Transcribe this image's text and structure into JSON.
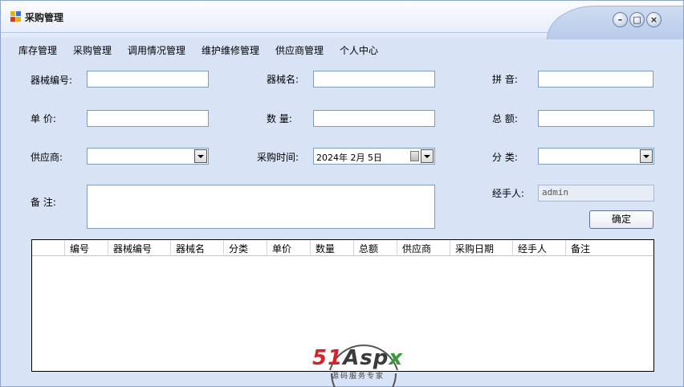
{
  "window": {
    "title": "采购管理",
    "controls": {
      "minimize_icon": "minimize-icon",
      "maximize_icon": "maximize-icon",
      "close_icon": "close-icon"
    }
  },
  "menu": {
    "items": [
      "库存管理",
      "采购管理",
      "调用情况管理",
      "维护维修管理",
      "供应商管理",
      "个人中心"
    ]
  },
  "form": {
    "equipment_no_label": "器械编号:",
    "equipment_name_label": "器械名:",
    "pinyin_label": "拼  音:",
    "unit_price_label": "单  价:",
    "quantity_label": "数  量:",
    "total_label": "总  额:",
    "supplier_label": "供应商:",
    "purchase_time_label": "采购时间:",
    "purchase_time_value": "2024年 2月 5日",
    "category_label": "分  类:",
    "remark_label": "备  注:",
    "handler_label": "经手人:",
    "handler_value": "admin",
    "confirm_label": "确定"
  },
  "grid": {
    "columns": [
      "",
      "编号",
      "器械编号",
      "器械名",
      "分类",
      "单价",
      "数量",
      "总额",
      "供应商",
      "采购日期",
      "经手人",
      "备注"
    ],
    "rows": []
  },
  "watermark": {
    "brand": "51Aspx",
    "tagline": "源码服务专家"
  },
  "colors": {
    "window_bg": "#d9e3f6",
    "border": "#7f9db9",
    "brand_red": "#d0262a",
    "brand_green": "#3a9a3a"
  }
}
